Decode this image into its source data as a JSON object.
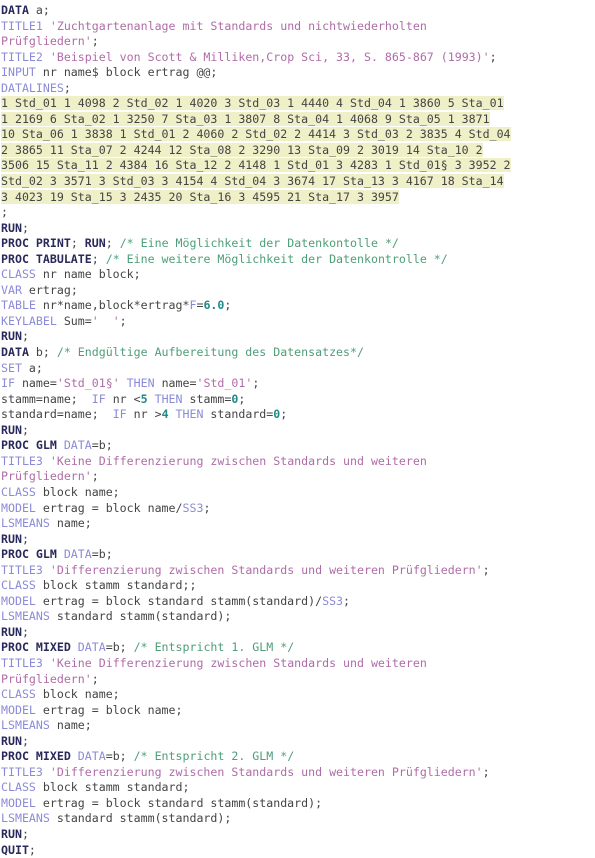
{
  "editor": {
    "language": "SAS",
    "background_color": "#ffffff",
    "datalines_highlight_color": "#eff0c8",
    "colors": {
      "keyword": "#28285a",
      "statement": "#8a8ad8",
      "string": "#b06ca8",
      "comment": "#4e9e78",
      "number": "#1f8a86",
      "plain": "#444444"
    }
  },
  "lines": [
    {
      "id": "l1",
      "tokens": [
        {
          "t": "kw",
          "v": "DATA"
        },
        {
          "t": "plain",
          "v": " a;"
        }
      ]
    },
    {
      "id": "l2",
      "tokens": [
        {
          "t": "stmt",
          "v": "TITLE1"
        },
        {
          "t": "plain",
          "v": " "
        },
        {
          "t": "str",
          "v": "'Zuchtgartenanlage mit Standards und nichtwiederholten"
        }
      ]
    },
    {
      "id": "l3",
      "tokens": [
        {
          "t": "str",
          "v": "Prüfgliedern'"
        },
        {
          "t": "plain",
          "v": ";"
        }
      ]
    },
    {
      "id": "l4",
      "tokens": [
        {
          "t": "stmt",
          "v": "TITLE2"
        },
        {
          "t": "plain",
          "v": " "
        },
        {
          "t": "str",
          "v": "'Beispiel von Scott & Milliken,Crop Sci, 33, S. 865-867 (1993)'"
        },
        {
          "t": "plain",
          "v": ";"
        }
      ]
    },
    {
      "id": "l5",
      "tokens": [
        {
          "t": "stmt",
          "v": "INPUT"
        },
        {
          "t": "plain",
          "v": " nr name$ block ertrag @@;"
        }
      ]
    },
    {
      "id": "l6",
      "tokens": [
        {
          "t": "stmt",
          "v": "DATALINES"
        },
        {
          "t": "plain",
          "v": ";"
        }
      ]
    },
    {
      "id": "l7",
      "datalines": true,
      "text": "1 Std_01 1 4098 2 Std_02 1 4020 3 Std_03 1 4440 4 Std_04 1 3860 5 Sta_01"
    },
    {
      "id": "l8",
      "datalines": true,
      "text": "1 2169 6 Sta_02 1 3250 7 Sta_03 1 3807 8 Sta_04 1 4068 9 Sta_05 1 3871"
    },
    {
      "id": "l9",
      "datalines": true,
      "text": "10 Sta_06 1 3838 1 Std_01 2 4060 2 Std_02 2 4414 3 Std_03 2 3835 4 Std_04"
    },
    {
      "id": "l10",
      "datalines": true,
      "text": "2 3865 11 Sta_07 2 4244 12 Sta_08 2 3290 13 Sta_09 2 3019 14 Sta_10 2"
    },
    {
      "id": "l11",
      "datalines": true,
      "text": "3506 15 Sta_11 2 4384 16 Sta_12 2 4148 1 Std_01 3 4283 1 Std_01§ 3 3952 2"
    },
    {
      "id": "l12",
      "datalines": true,
      "text": "Std_02 3 3571 3 Std_03 3 4154 4 Std_04 3 3674 17 Sta_13 3 4167 18 Sta_14"
    },
    {
      "id": "l13",
      "datalines": true,
      "text": "3 4023 19 Sta_15 3 2435 20 Sta_16 3 4595 21 Sta_17 3 3957"
    },
    {
      "id": "l14",
      "tokens": [
        {
          "t": "plain",
          "v": ";"
        }
      ]
    },
    {
      "id": "l15",
      "tokens": [
        {
          "t": "kw",
          "v": "RUN"
        },
        {
          "t": "plain",
          "v": ";"
        }
      ]
    },
    {
      "id": "l16",
      "tokens": [
        {
          "t": "kw",
          "v": "PROC PRINT"
        },
        {
          "t": "plain",
          "v": "; "
        },
        {
          "t": "kw",
          "v": "RUN"
        },
        {
          "t": "plain",
          "v": "; "
        },
        {
          "t": "cmt",
          "v": "/* Eine Möglichkeit der Datenkontolle */"
        }
      ]
    },
    {
      "id": "l17",
      "tokens": [
        {
          "t": "kw",
          "v": "PROC TABULATE"
        },
        {
          "t": "plain",
          "v": "; "
        },
        {
          "t": "cmt",
          "v": "/* Eine weitere Möglichkeit der Datenkontrolle */"
        }
      ]
    },
    {
      "id": "l18",
      "tokens": [
        {
          "t": "stmt",
          "v": "CLASS"
        },
        {
          "t": "plain",
          "v": " nr name block;"
        }
      ]
    },
    {
      "id": "l19",
      "tokens": [
        {
          "t": "stmt",
          "v": "VAR"
        },
        {
          "t": "plain",
          "v": " ertrag;"
        }
      ]
    },
    {
      "id": "l20",
      "tokens": [
        {
          "t": "stmt",
          "v": "TABLE"
        },
        {
          "t": "plain",
          "v": " nr*name,block*ertrag*"
        },
        {
          "t": "stmt",
          "v": "F"
        },
        {
          "t": "plain",
          "v": "="
        },
        {
          "t": "num",
          "v": "6.0"
        },
        {
          "t": "plain",
          "v": ";"
        }
      ]
    },
    {
      "id": "l21",
      "tokens": [
        {
          "t": "stmt",
          "v": "KEYLABEL"
        },
        {
          "t": "plain",
          "v": " Sum="
        },
        {
          "t": "str",
          "v": "'  '"
        },
        {
          "t": "plain",
          "v": ";"
        }
      ]
    },
    {
      "id": "l22",
      "tokens": [
        {
          "t": "kw",
          "v": "RUN"
        },
        {
          "t": "plain",
          "v": ";"
        }
      ]
    },
    {
      "id": "l23",
      "tokens": [
        {
          "t": "kw",
          "v": "DATA"
        },
        {
          "t": "plain",
          "v": " b; "
        },
        {
          "t": "cmt",
          "v": "/* Endgültige Aufbereitung des Datensatzes*/"
        }
      ]
    },
    {
      "id": "l24",
      "tokens": [
        {
          "t": "stmt",
          "v": "SET"
        },
        {
          "t": "plain",
          "v": " a;"
        }
      ]
    },
    {
      "id": "l25",
      "tokens": [
        {
          "t": "stmt",
          "v": "IF"
        },
        {
          "t": "plain",
          "v": " name="
        },
        {
          "t": "str",
          "v": "'Std_01§'"
        },
        {
          "t": "plain",
          "v": " "
        },
        {
          "t": "stmt",
          "v": "THEN"
        },
        {
          "t": "plain",
          "v": " name="
        },
        {
          "t": "str",
          "v": "'Std_01'"
        },
        {
          "t": "plain",
          "v": ";"
        }
      ]
    },
    {
      "id": "l26",
      "tokens": [
        {
          "t": "plain",
          "v": "stamm=name;  "
        },
        {
          "t": "stmt",
          "v": "IF"
        },
        {
          "t": "plain",
          "v": " nr <"
        },
        {
          "t": "num",
          "v": "5"
        },
        {
          "t": "plain",
          "v": " "
        },
        {
          "t": "stmt",
          "v": "THEN"
        },
        {
          "t": "plain",
          "v": " stamm="
        },
        {
          "t": "num",
          "v": "0"
        },
        {
          "t": "plain",
          "v": ";"
        }
      ]
    },
    {
      "id": "l27",
      "tokens": [
        {
          "t": "plain",
          "v": "standard=name;  "
        },
        {
          "t": "stmt",
          "v": "IF"
        },
        {
          "t": "plain",
          "v": " nr >"
        },
        {
          "t": "num",
          "v": "4"
        },
        {
          "t": "plain",
          "v": " "
        },
        {
          "t": "stmt",
          "v": "THEN"
        },
        {
          "t": "plain",
          "v": " standard="
        },
        {
          "t": "num",
          "v": "0"
        },
        {
          "t": "plain",
          "v": ";"
        }
      ]
    },
    {
      "id": "l28",
      "tokens": [
        {
          "t": "kw",
          "v": "RUN"
        },
        {
          "t": "plain",
          "v": ";"
        }
      ]
    },
    {
      "id": "l29",
      "tokens": [
        {
          "t": "kw",
          "v": "PROC GLM"
        },
        {
          "t": "plain",
          "v": " "
        },
        {
          "t": "stmt",
          "v": "DATA"
        },
        {
          "t": "plain",
          "v": "=b;"
        }
      ]
    },
    {
      "id": "l30",
      "tokens": [
        {
          "t": "stmt",
          "v": "TITLE3"
        },
        {
          "t": "plain",
          "v": " "
        },
        {
          "t": "str",
          "v": "'Keine Differenzierung zwischen Standards und weiteren"
        }
      ]
    },
    {
      "id": "l31",
      "tokens": [
        {
          "t": "str",
          "v": "Prüfgliedern'"
        },
        {
          "t": "plain",
          "v": ";"
        }
      ]
    },
    {
      "id": "l32",
      "tokens": [
        {
          "t": "stmt",
          "v": "CLASS"
        },
        {
          "t": "plain",
          "v": " block name;"
        }
      ]
    },
    {
      "id": "l33",
      "tokens": [
        {
          "t": "stmt",
          "v": "MODEL"
        },
        {
          "t": "plain",
          "v": " ertrag = block name/"
        },
        {
          "t": "stmt",
          "v": "SS3"
        },
        {
          "t": "plain",
          "v": ";"
        }
      ]
    },
    {
      "id": "l34",
      "tokens": [
        {
          "t": "stmt",
          "v": "LSMEANS"
        },
        {
          "t": "plain",
          "v": " name;"
        }
      ]
    },
    {
      "id": "l35",
      "tokens": [
        {
          "t": "kw",
          "v": "RUN"
        },
        {
          "t": "plain",
          "v": ";"
        }
      ]
    },
    {
      "id": "l36",
      "tokens": [
        {
          "t": "kw",
          "v": "PROC GLM"
        },
        {
          "t": "plain",
          "v": " "
        },
        {
          "t": "stmt",
          "v": "DATA"
        },
        {
          "t": "plain",
          "v": "=b;"
        }
      ]
    },
    {
      "id": "l37",
      "tokens": [
        {
          "t": "stmt",
          "v": "TITLE3"
        },
        {
          "t": "plain",
          "v": " "
        },
        {
          "t": "str",
          "v": "'Differenzierung zwischen Standards und weiteren Prüfgliedern'"
        },
        {
          "t": "plain",
          "v": ";"
        }
      ]
    },
    {
      "id": "l38",
      "tokens": [
        {
          "t": "stmt",
          "v": "CLASS"
        },
        {
          "t": "plain",
          "v": " block stamm standard;;"
        }
      ]
    },
    {
      "id": "l39",
      "tokens": [
        {
          "t": "stmt",
          "v": "MODEL"
        },
        {
          "t": "plain",
          "v": " ertrag = block standard stamm(standard)/"
        },
        {
          "t": "stmt",
          "v": "SS3"
        },
        {
          "t": "plain",
          "v": ";"
        }
      ]
    },
    {
      "id": "l40",
      "tokens": [
        {
          "t": "stmt",
          "v": "LSMEANS"
        },
        {
          "t": "plain",
          "v": " standard stamm(standard);"
        }
      ]
    },
    {
      "id": "l41",
      "tokens": [
        {
          "t": "kw",
          "v": "RUN"
        },
        {
          "t": "plain",
          "v": ";"
        }
      ]
    },
    {
      "id": "l42",
      "tokens": [
        {
          "t": "kw",
          "v": "PROC MIXED"
        },
        {
          "t": "plain",
          "v": " "
        },
        {
          "t": "stmt",
          "v": "DATA"
        },
        {
          "t": "plain",
          "v": "=b; "
        },
        {
          "t": "cmt",
          "v": "/* Entspricht 1. GLM */"
        }
      ]
    },
    {
      "id": "l43",
      "tokens": [
        {
          "t": "stmt",
          "v": "TITLE3"
        },
        {
          "t": "plain",
          "v": " "
        },
        {
          "t": "str",
          "v": "'Keine Differenzierung zwischen Standards und weiteren"
        }
      ]
    },
    {
      "id": "l44",
      "tokens": [
        {
          "t": "str",
          "v": "Prüfgliedern'"
        },
        {
          "t": "plain",
          "v": ";"
        }
      ]
    },
    {
      "id": "l45",
      "tokens": [
        {
          "t": "stmt",
          "v": "CLASS"
        },
        {
          "t": "plain",
          "v": " block name;"
        }
      ]
    },
    {
      "id": "l46",
      "tokens": [
        {
          "t": "stmt",
          "v": "MODEL"
        },
        {
          "t": "plain",
          "v": " ertrag = block name;"
        }
      ]
    },
    {
      "id": "l47",
      "tokens": [
        {
          "t": "stmt",
          "v": "LSMEANS"
        },
        {
          "t": "plain",
          "v": " name;"
        }
      ]
    },
    {
      "id": "l48",
      "tokens": [
        {
          "t": "kw",
          "v": "RUN"
        },
        {
          "t": "plain",
          "v": ";"
        }
      ]
    },
    {
      "id": "l49",
      "tokens": [
        {
          "t": "kw",
          "v": "PROC MIXED"
        },
        {
          "t": "plain",
          "v": " "
        },
        {
          "t": "stmt",
          "v": "DATA"
        },
        {
          "t": "plain",
          "v": "=b; "
        },
        {
          "t": "cmt",
          "v": "/* Entspricht 2. GLM */"
        }
      ]
    },
    {
      "id": "l50",
      "tokens": [
        {
          "t": "stmt",
          "v": "TITLE3"
        },
        {
          "t": "plain",
          "v": " "
        },
        {
          "t": "str",
          "v": "'Differenzierung zwischen Standards und weiteren Prüfgliedern'"
        },
        {
          "t": "plain",
          "v": ";"
        }
      ]
    },
    {
      "id": "l51",
      "tokens": [
        {
          "t": "stmt",
          "v": "CLASS"
        },
        {
          "t": "plain",
          "v": " block stamm standard;"
        }
      ]
    },
    {
      "id": "l52",
      "tokens": [
        {
          "t": "stmt",
          "v": "MODEL"
        },
        {
          "t": "plain",
          "v": " ertrag = block standard stamm(standard);"
        }
      ]
    },
    {
      "id": "l53",
      "tokens": [
        {
          "t": "stmt",
          "v": "LSMEANS"
        },
        {
          "t": "plain",
          "v": " standard stamm(standard);"
        }
      ]
    },
    {
      "id": "l54",
      "tokens": [
        {
          "t": "kw",
          "v": "RUN"
        },
        {
          "t": "plain",
          "v": ";"
        }
      ]
    },
    {
      "id": "l55",
      "tokens": [
        {
          "t": "kw",
          "v": "QUIT"
        },
        {
          "t": "plain",
          "v": ";"
        }
      ]
    }
  ]
}
